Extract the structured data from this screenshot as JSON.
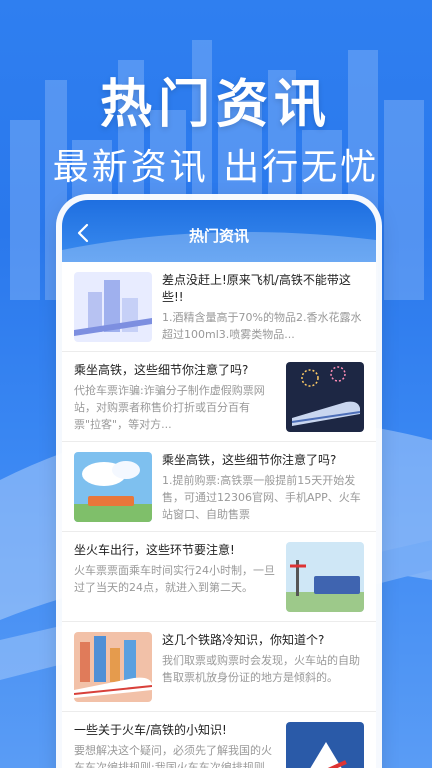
{
  "banner": {
    "headline": "热门资讯",
    "subline": "最新资讯 出行无忧"
  },
  "phone": {
    "header_title": "热门资讯",
    "back_icon": "chevron-left-icon"
  },
  "articles": [
    {
      "title": "差点没赶上!原来飞机/高铁不能带这些!!",
      "desc": "1.酒精含量高于70%的物品2.香水花露水超过100ml3.喷雾类物品...",
      "thumb": "city-buildings-illustration"
    },
    {
      "title": "乘坐高铁，这些细节你注意了吗?",
      "desc": "代抢车票诈骗:诈骗分子制作虚假购票网站，对购票者称售价打折或百分百有票\"拉客\"，等对方...",
      "thumb": "fireworks-train-illustration"
    },
    {
      "title": "乘坐高铁，这些细节你注意了吗?",
      "desc": "1.提前购票:高铁票一般提前15天开始发售，可通过12306官网、手机APP、火车站窗口、自助售票",
      "thumb": "cloud-train-illustration"
    },
    {
      "title": "坐火车出行，这些环节要注意!",
      "desc": "火车票票面乘车时间实行24小时制，一旦过了当天的24点，就进入到第二天。",
      "thumb": "railway-crossing-illustration"
    },
    {
      "title": "这几个铁路冷知识，你知道个?",
      "desc": "我们取票或购票时会发现，火车站的自助售取票机放身份证的地方是倾斜的。",
      "thumb": "city-highspeed-train-illustration"
    },
    {
      "title": "一些关于火车/高铁的小知识!",
      "desc": "要想解决这个疑问，必须先了解我国的火车车次编排规则:我国火车车次编排规则",
      "thumb": "snow-mountain-train-illustration"
    }
  ]
}
